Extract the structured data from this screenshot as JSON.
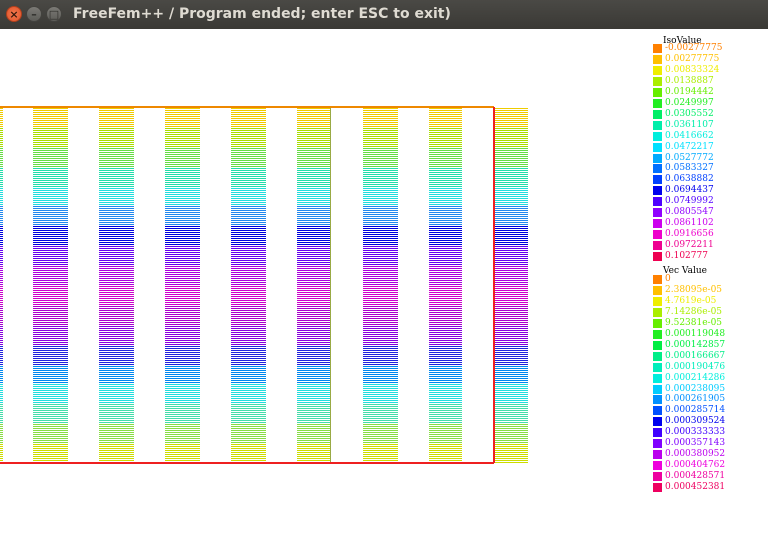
{
  "window": {
    "title": "FreeFem++ / Program ended; enter ESC to exit)",
    "close_glyph": "×",
    "minimize_glyph": "–",
    "maximize_glyph": "□"
  },
  "iso_legend": {
    "title": "IsoValue",
    "items": [
      {
        "label": "-0.00277775",
        "color": "#ff8000"
      },
      {
        "label": "0.00277775",
        "color": "#ffc000"
      },
      {
        "label": "0.00833324",
        "color": "#eeee00"
      },
      {
        "label": "0.0138887",
        "color": "#aaee00"
      },
      {
        "label": "0.0194442",
        "color": "#66ee00"
      },
      {
        "label": "0.0249997",
        "color": "#22ee22"
      },
      {
        "label": "0.0305552",
        "color": "#00ee66"
      },
      {
        "label": "0.0361107",
        "color": "#00eeaa"
      },
      {
        "label": "0.0416662",
        "color": "#00eedd"
      },
      {
        "label": "0.0472217",
        "color": "#00e0ff"
      },
      {
        "label": "0.0527772",
        "color": "#00aaff"
      },
      {
        "label": "0.0583327",
        "color": "#0070ff"
      },
      {
        "label": "0.0638882",
        "color": "#0040ff"
      },
      {
        "label": "0.0694437",
        "color": "#0000ee"
      },
      {
        "label": "0.0749992",
        "color": "#5000ff"
      },
      {
        "label": "0.0805547",
        "color": "#9000ff"
      },
      {
        "label": "0.0861102",
        "color": "#cc00ee"
      },
      {
        "label": "0.0916656",
        "color": "#ee00cc"
      },
      {
        "label": "0.0972211",
        "color": "#ee0090"
      },
      {
        "label": "0.102777",
        "color": "#ee0050"
      }
    ]
  },
  "vec_legend": {
    "title": "Vec Value",
    "items": [
      {
        "label": "0",
        "color": "#ff8000"
      },
      {
        "label": "2.38095e-05",
        "color": "#ffc000"
      },
      {
        "label": "4.7619e-05",
        "color": "#eeee00"
      },
      {
        "label": "7.14286e-05",
        "color": "#aaee00"
      },
      {
        "label": "9.52381e-05",
        "color": "#66ee00"
      },
      {
        "label": "0.000119048",
        "color": "#22ee22"
      },
      {
        "label": "0.000142857",
        "color": "#00ee44"
      },
      {
        "label": "0.000166667",
        "color": "#00ee88"
      },
      {
        "label": "0.000190476",
        "color": "#00eebb"
      },
      {
        "label": "0.000214286",
        "color": "#00eedd"
      },
      {
        "label": "0.000238095",
        "color": "#00ccff"
      },
      {
        "label": "0.000261905",
        "color": "#0090ff"
      },
      {
        "label": "0.000285714",
        "color": "#0050ff"
      },
      {
        "label": "0.000309524",
        "color": "#0000ee"
      },
      {
        "label": "0.000333333",
        "color": "#4000ff"
      },
      {
        "label": "0.000357143",
        "color": "#8000ff"
      },
      {
        "label": "0.000380952",
        "color": "#bb00ee"
      },
      {
        "label": "0.000404762",
        "color": "#ee00dd"
      },
      {
        "label": "0.000428571",
        "color": "#ee00a0"
      },
      {
        "label": "0.000452381",
        "color": "#ee0060"
      }
    ]
  },
  "plot": {
    "mesh_outline_colors": {
      "top": "#ee8800",
      "right": "#ee2020",
      "bottom": "#ee2020"
    },
    "band_palette": [
      "#eecc00",
      "#aadd00",
      "#66dd44",
      "#22ddaa",
      "#22dddd",
      "#2288ee",
      "#0000dd",
      "#6600ee",
      "#aa00dd",
      "#cc00cc",
      "#aa00cc",
      "#8800dd",
      "#2222dd",
      "#0088ee",
      "#22dddd",
      "#44ddaa",
      "#88dd44",
      "#ccdd00"
    ]
  }
}
